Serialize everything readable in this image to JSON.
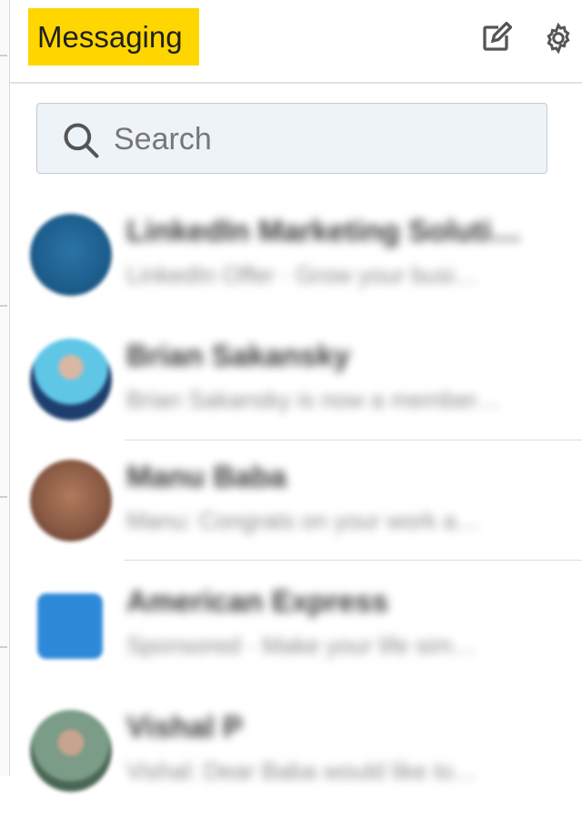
{
  "header": {
    "title": "Messaging",
    "compose_icon": "compose-icon",
    "settings_icon": "gear-icon"
  },
  "search": {
    "placeholder": "Search",
    "icon": "search-icon"
  },
  "conversations": [
    {
      "name": "LinkedIn Marketing Soluti…",
      "preview": "LinkedIn Offer · Grow your busi…",
      "avatar_color": "#1c5d8c"
    },
    {
      "name": "Brian Sakansky",
      "preview": "Brian Sakansky is now a member…",
      "avatar_color": "#5fc6e6"
    },
    {
      "name": "Manu Baba",
      "preview": "Manu: Congrats on your work a…",
      "avatar_color": "#8a5a44"
    },
    {
      "name": "American Express",
      "preview": "Sponsored · Make your life sim…",
      "avatar_color": "#2e8ad8"
    },
    {
      "name": "Vishal P",
      "preview": "Vishal: Dear Baba would like to…",
      "avatar_color": "#7b9c86"
    }
  ],
  "colors": {
    "title_highlight": "#ffd600",
    "search_bg": "#eef3f8"
  }
}
